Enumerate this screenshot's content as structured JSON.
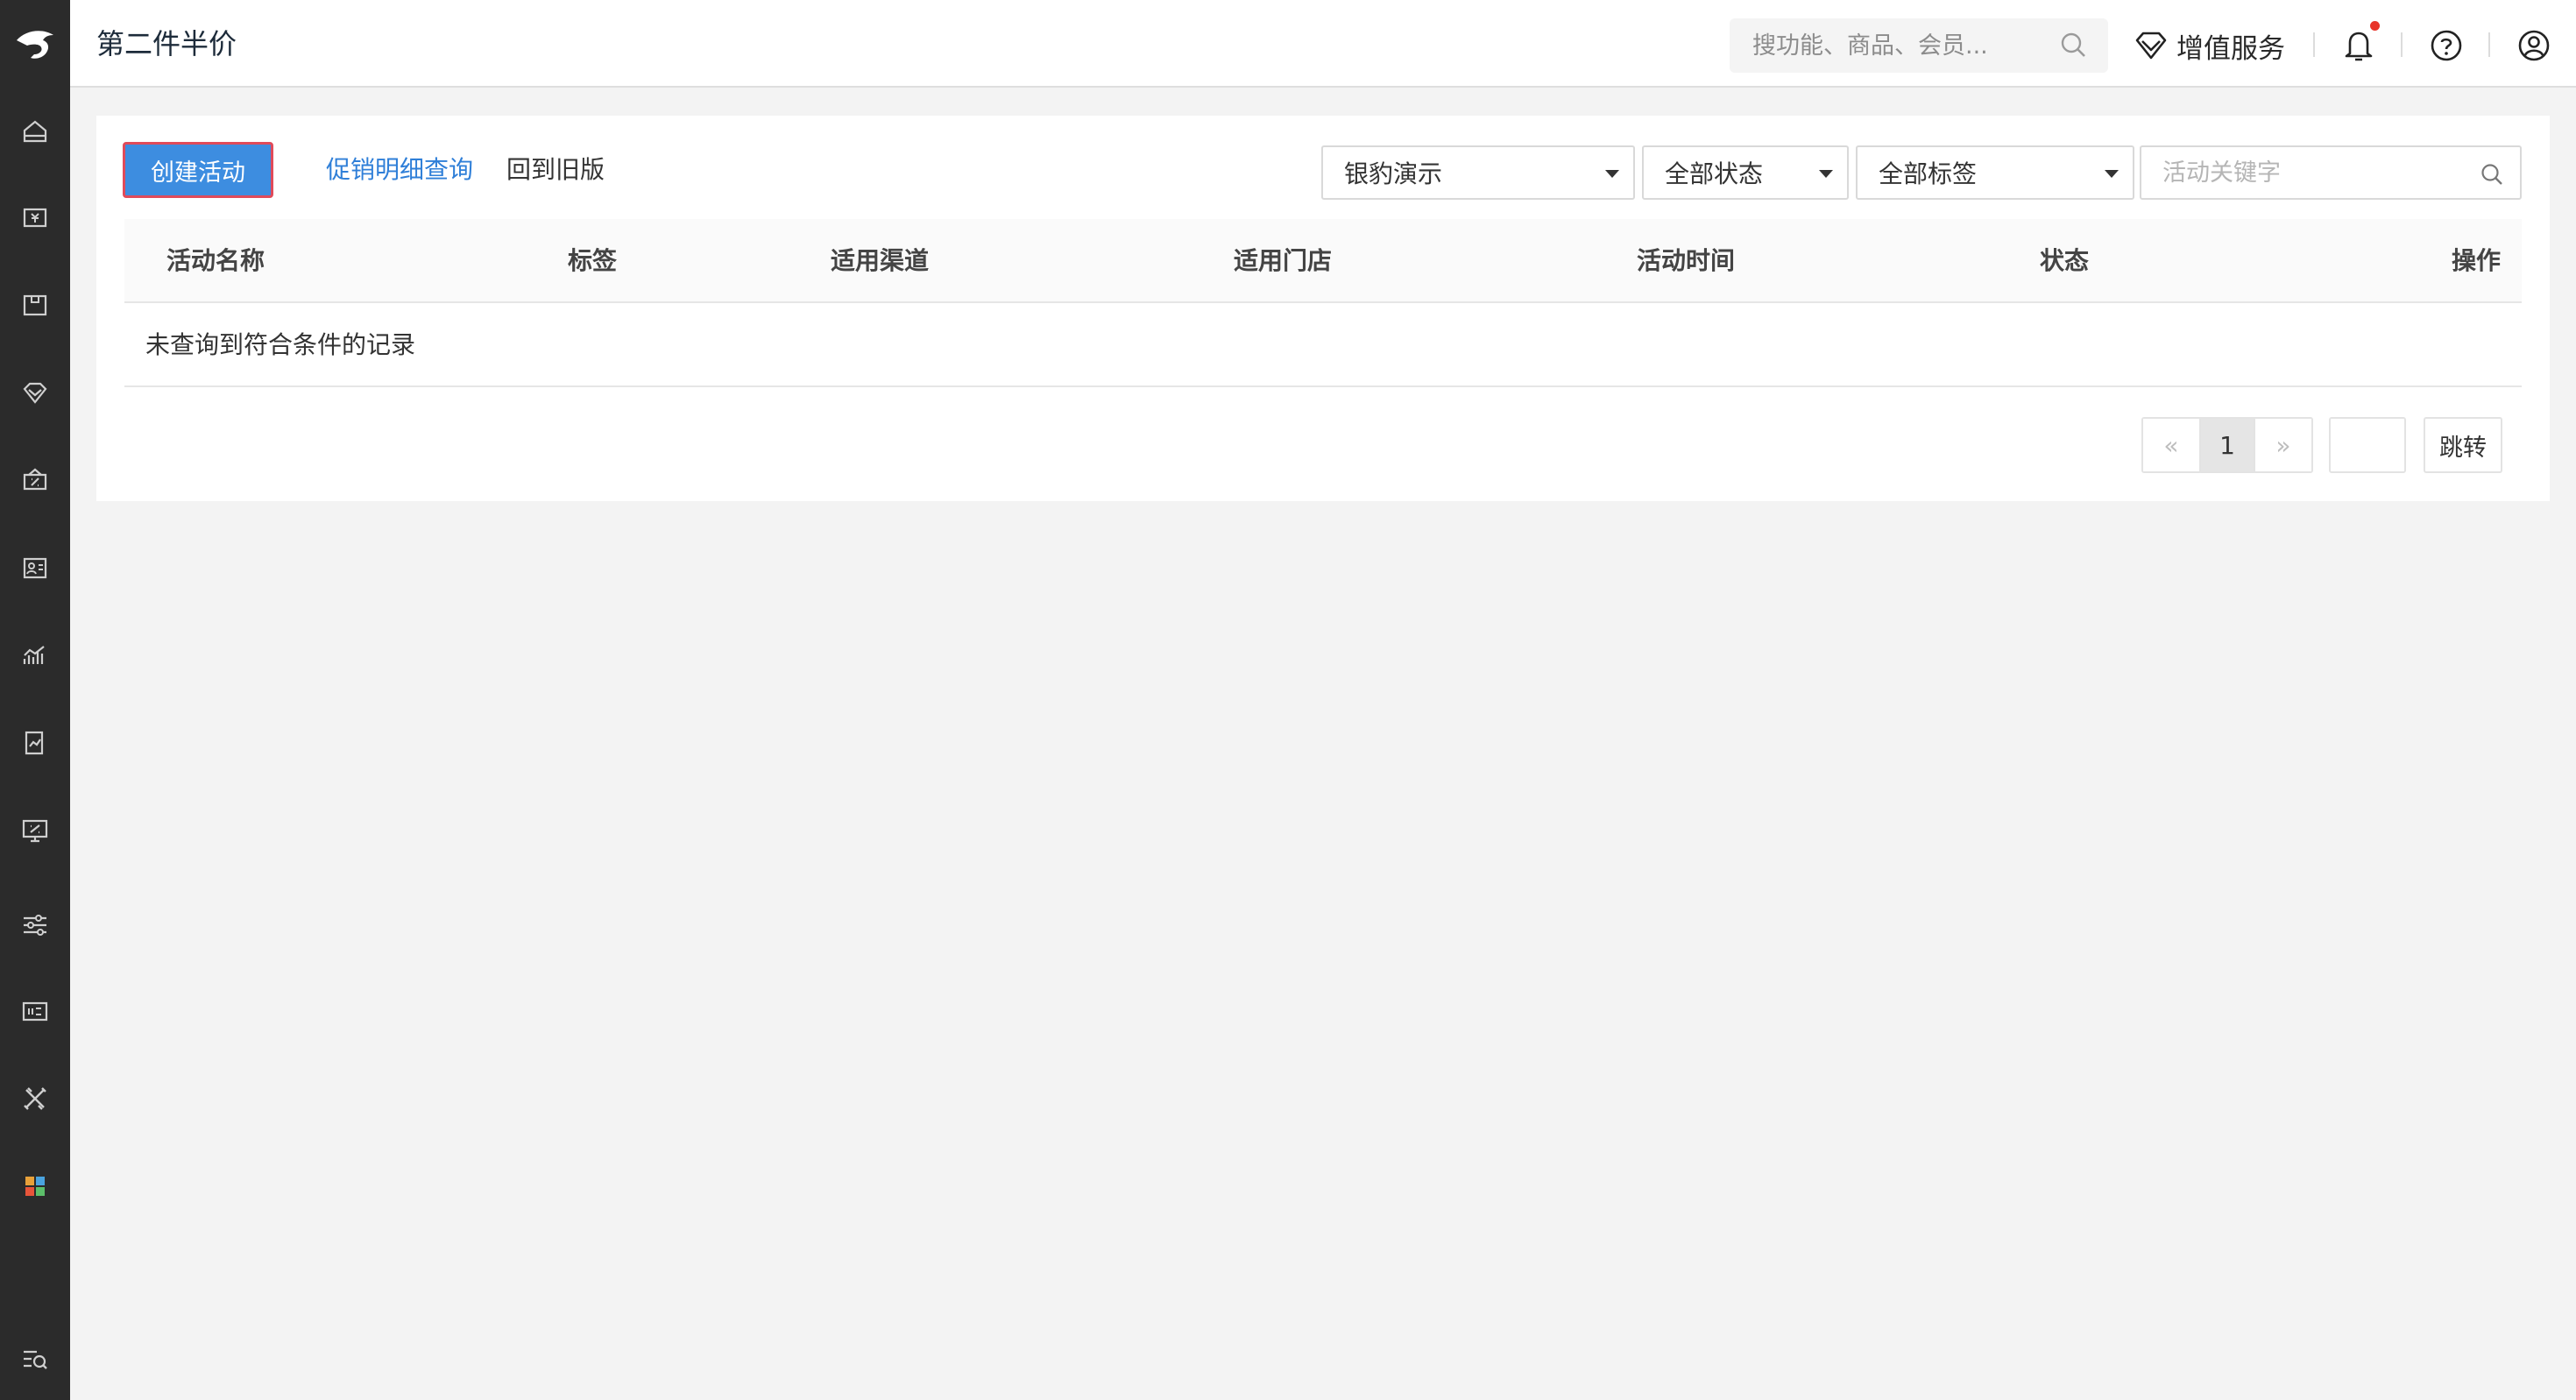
{
  "header": {
    "title": "第二件半价",
    "search_placeholder": "搜功能、商品、会员...",
    "vas_label": "增值服务"
  },
  "sidebar": {
    "items": [
      {
        "icon": "home-icon"
      },
      {
        "icon": "cashier-icon"
      },
      {
        "icon": "goods-icon"
      },
      {
        "icon": "member-icon"
      },
      {
        "icon": "marketing-icon"
      },
      {
        "icon": "staff-icon"
      },
      {
        "icon": "report-icon"
      },
      {
        "icon": "finance-icon"
      },
      {
        "icon": "online-store-icon"
      },
      {
        "icon": "settings-icon"
      },
      {
        "icon": "device-icon"
      },
      {
        "icon": "tools-icon"
      },
      {
        "icon": "apps-icon"
      },
      {
        "icon": "menu-search-icon"
      }
    ]
  },
  "toolbar": {
    "create_label": "创建活动",
    "detail_link": "促销明细查询",
    "old_version_link": "回到旧版",
    "store_select": "银豹演示",
    "status_select": "全部状态",
    "tag_select": "全部标签",
    "keyword_placeholder": "活动关键字"
  },
  "table": {
    "columns": [
      "活动名称",
      "标签",
      "适用渠道",
      "适用门店",
      "活动时间",
      "状态",
      "操作"
    ],
    "empty_text": "未查询到符合条件的记录"
  },
  "pagination": {
    "prev": "«",
    "current": "1",
    "next": "»",
    "jump_label": "跳转"
  },
  "colors": {
    "sidebar_bg": "#2b2b2b",
    "primary": "#3d8de0",
    "link": "#2f7fd8",
    "notification_dot": "#e8342a"
  }
}
